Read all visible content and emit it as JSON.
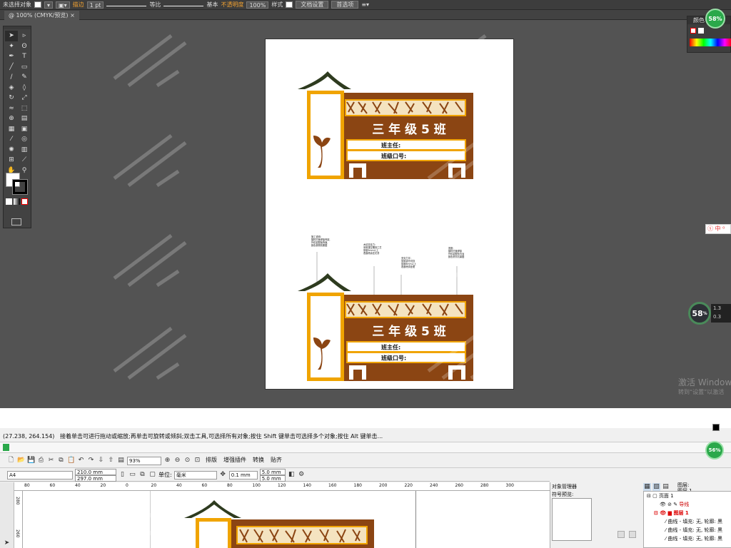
{
  "illustrator": {
    "control_bar": {
      "selection": "未选择对象",
      "stroke_label": "描边",
      "stroke_weight": "1 pt",
      "stroke_profile": "等比",
      "brush": "基本",
      "opacity_label": "不透明度",
      "opacity_value": "100%",
      "style_label": "样式",
      "doc_setup_button": "文档设置",
      "prefs_button": "首选项"
    },
    "doc_tab": "@ 100% (CMYK/预览)",
    "color_panel_title": "颜色",
    "ime": "中",
    "meter_top": "58%",
    "meter_bottom": "58",
    "meter_bottom_unit": "%",
    "meter_stats": [
      "1.3",
      "0.3"
    ],
    "activate_windows": "激活 Windows",
    "activate_hint": "转到“设置”以激活"
  },
  "signboard": {
    "class_name": "三 年 级 5 班",
    "head_teacher": "班主任:",
    "slogan": "班级口号:",
    "colors": {
      "brown": "#8b4513",
      "orange": "#f0a400",
      "roof": "#2e3b1f",
      "cream": "#f4e3c0"
    }
  },
  "annotations": [
    [
      "施工说明:",
      "镀锌方管焊接骨架,",
      "外包铝塑板饰面,",
      "颜色参照效果图"
    ],
    [
      "木纹亚克力:",
      "采用镂空雕刻工艺",
      "厚度5mm以上",
      "表面喷涂亚光漆"
    ],
    [
      "亚克力字:",
      "采用激光切割",
      "厚度8mm以上",
      "表面喷漆处理"
    ],
    [
      "底座:",
      "镀锌方管焊接",
      "外包铝塑板饰面",
      "颜色参照效果图"
    ]
  ],
  "coreldraw": {
    "status_coords": "(27.238, 264.154)",
    "status_hint": "接着单击可进行拖动或缩放;再单击可旋转或倾斜;双击工具,可选择所有对象;按住 Shift 键单击可选择多个对象;按住 Alt 键单击...",
    "zoom": "93%",
    "menu_buttons": [
      "排版",
      "增强插件",
      "转换",
      "贴齐"
    ],
    "page_size": "A4",
    "width": "210.0 mm",
    "height": "297.0 mm",
    "units_label": "单位:",
    "units": "毫米",
    "nudge": "0.1 mm",
    "dup_x": "5.0 mm",
    "dup_y": "5.0 mm",
    "ruler_ticks": [
      "80",
      "60",
      "40",
      "20",
      "0",
      "20",
      "40",
      "60",
      "80",
      "100",
      "120",
      "140",
      "160",
      "180",
      "200",
      "220",
      "240",
      "260",
      "280",
      "300"
    ],
    "vruler_ticks": [
      "280",
      "260"
    ],
    "object_manager_title": "对象管理器",
    "symbol_preview": "符号预览:",
    "tree": {
      "header": [
        "图层:",
        "图层 1"
      ],
      "page": "页面 1",
      "guides": "导线",
      "layer": "图层 1",
      "curves": [
        "曲线 - 填充: 无, 轮廓: 黑",
        "曲线 - 填充: 无, 轮廓: 黑",
        "曲线 - 填充: 无, 轮廓: 黑"
      ]
    },
    "meter": "56%"
  }
}
